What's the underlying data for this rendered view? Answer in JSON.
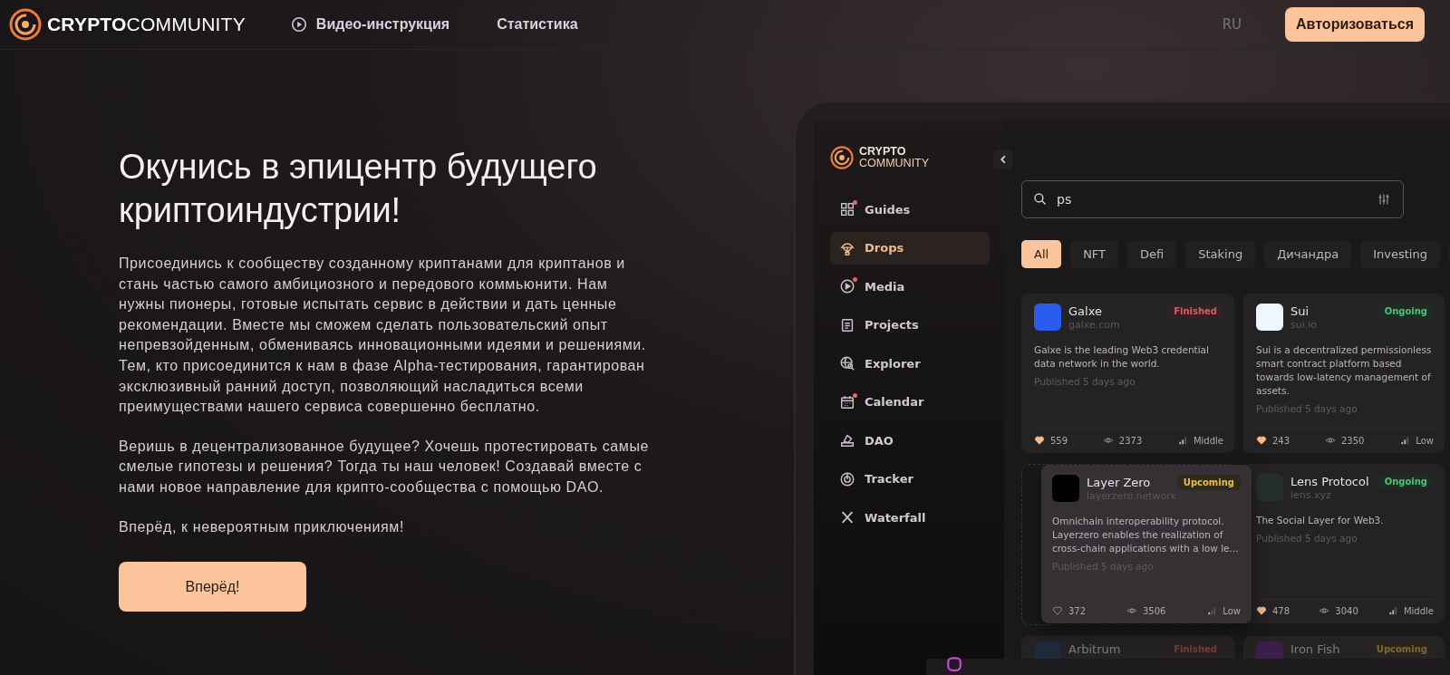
{
  "header": {
    "logo_bold": "CRYPTO",
    "logo_light": "COMMUNITY",
    "nav": [
      {
        "label": "Видео-инструкция",
        "kind": "video"
      },
      {
        "label": "Статистика",
        "kind": "plain"
      }
    ],
    "language": {
      "label": "RU",
      "active": false
    },
    "login": "Авторизоваться"
  },
  "hero": {
    "title": "Окунись в эпицентр будущего криптоиндустрии!",
    "paragraphs": [
      "Присоединись к сообществу созданному криптанами для криптанов и стань частью самого амбициозного и передового коммьюнити. Нам нужны пионеры, готовые испытать сервис в действии и дать ценные рекомендации. Вместе мы сможем сделать пользовательский опыт непревзойденным, обмениваясь инновационными идеями и решениями. Тем, кто присоединится к нам в фазе Alpha-тестирования, гарантирован эксклюзивный ранний доступ, позволяющий насладиться всеми преимуществами нашего сервиса совершенно бесплатно.",
      "Веришь в децентрализованное будущее? Хочешь протестировать самые смелые гипотезы и решения? Тогда ты наш человек! Создавай вместе с нами новое направление для крипто-сообщества с помощью DAO.",
      "Вперёд, к невероятным приключениям!"
    ],
    "button": "Вперёд!"
  },
  "mockup": {
    "logo_bold": "CRYPTO",
    "logo_light": "COMMUNITY",
    "sidebar": [
      {
        "label": "Guides",
        "kind": "grid",
        "selected": false,
        "badge": true
      },
      {
        "label": "Drops",
        "kind": "parachute",
        "selected": true,
        "badge": false
      },
      {
        "label": "Media",
        "kind": "play",
        "selected": false,
        "badge": true
      },
      {
        "label": "Projects",
        "kind": "doc",
        "selected": false,
        "badge": false
      },
      {
        "label": "Explorer",
        "kind": "globe",
        "selected": false,
        "badge": false
      },
      {
        "label": "Calendar",
        "kind": "calendar",
        "selected": false,
        "badge": true
      },
      {
        "label": "DAO",
        "kind": "vote",
        "selected": false,
        "badge": false
      },
      {
        "label": "Tracker",
        "kind": "target",
        "selected": false,
        "badge": false
      },
      {
        "label": "Waterfall",
        "kind": "x",
        "selected": false,
        "badge": false
      }
    ],
    "search": {
      "value": "ps"
    },
    "filters": [
      {
        "label": "All",
        "selected": true
      },
      {
        "label": "NFT",
        "selected": false
      },
      {
        "label": "Defi",
        "selected": false
      },
      {
        "label": "Staking",
        "selected": false
      },
      {
        "label": "Дичандра",
        "selected": false
      },
      {
        "label": "Investing",
        "selected": false
      }
    ],
    "cards": [
      {
        "name": "Galxe",
        "domain": "galxe.com",
        "status": "Finished",
        "kind": "finished",
        "color": "#2a5cf0",
        "description": "Galxe is the leading Web3 credential data network in the world.",
        "published": "Published 5 days ago",
        "likes": "559",
        "liked": true,
        "views": "2373",
        "activity": "Middle"
      },
      {
        "name": "Sui",
        "domain": "sui.io",
        "status": "Ongoing",
        "kind": "ongoing",
        "color": "#eef6ff",
        "description": "Sui is a decentralized permissionless smart contract platform based towards low-latency management of assets.",
        "published": "Published 5 days ago",
        "likes": "243",
        "liked": true,
        "views": "2350",
        "activity": "Low"
      },
      {
        "name": "Lens Protocol",
        "domain": "lens.xyz",
        "status": "Ongoing",
        "kind": "ongoing",
        "color": "#26302a",
        "description": "The Social Layer for Web3.",
        "published": "Published 5 days ago",
        "likes": "478",
        "liked": true,
        "views": "3040",
        "activity": "Middle"
      }
    ],
    "dragged_card": {
      "name": "Layer Zero",
      "domain": "layerzero.network",
      "status": "Upcoming",
      "kind": "upcoming",
      "color": "#000000",
      "description": "Omnichain interoperability protocol. Layerzero enables the realization of cross-chain applications with a low le...",
      "published": "Published 5 days ago",
      "likes": "372",
      "liked": false,
      "views": "3506",
      "activity": "Low"
    },
    "peek_cards": [
      {
        "name": "Arbitrum",
        "status": "Finished",
        "kind": "finished",
        "color": "#1f2a3a"
      },
      {
        "name": "Iron Fish",
        "status": "Upcoming",
        "kind": "upcoming",
        "color": "#3a1f4a"
      }
    ]
  }
}
